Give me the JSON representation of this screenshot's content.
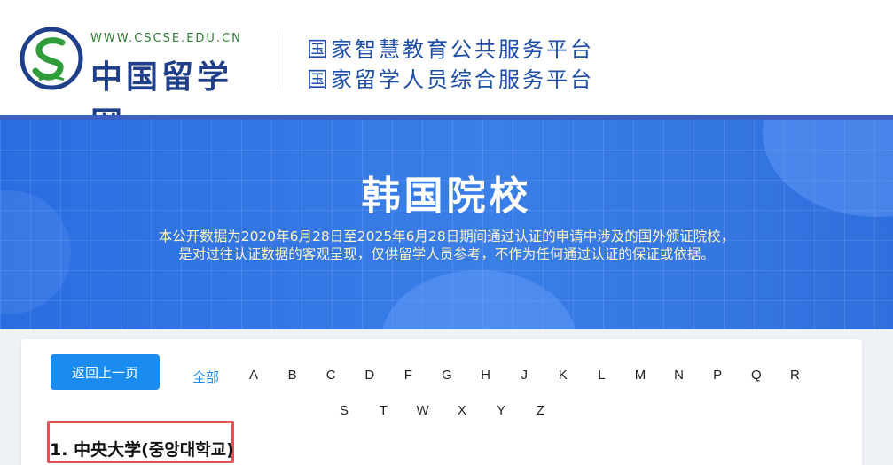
{
  "header": {
    "logo_url_text": "WWW.CSCSE.EDU.CN",
    "logo_name": "中国留学网",
    "platform_line_1": "国家智慧教育公共服务平台",
    "platform_line_2": "国家留学人员综合服务平台"
  },
  "banner": {
    "title": "韩国院校",
    "description_line_1": "本公开数据为2020年6月28日至2025年6月28日期间通过认证的申请中涉及的国外颁证院校，",
    "description_line_2": "是对过往认证数据的客观呈现，仅供留学人员参考，不作为任何通过认证的保证或依据。"
  },
  "content": {
    "back_button_label": "返回上一页",
    "filter_all_label": "全部",
    "letters_row_1": [
      "A",
      "B",
      "C",
      "D",
      "F",
      "G",
      "H",
      "J",
      "K",
      "L",
      "M",
      "N",
      "P",
      "Q",
      "R"
    ],
    "letters_row_2": [
      "S",
      "T",
      "W",
      "X",
      "Y",
      "Z"
    ],
    "active_filter": "全部",
    "schools": [
      {
        "index": "1.",
        "name": "中央大学(중앙대학교)"
      }
    ]
  },
  "colors": {
    "accent": "#1a8cf0",
    "banner_blue": "#2a6de0",
    "banner_desc": "#fff4c4",
    "highlight_border": "#e05353",
    "platform_text": "#1e4fa8"
  }
}
